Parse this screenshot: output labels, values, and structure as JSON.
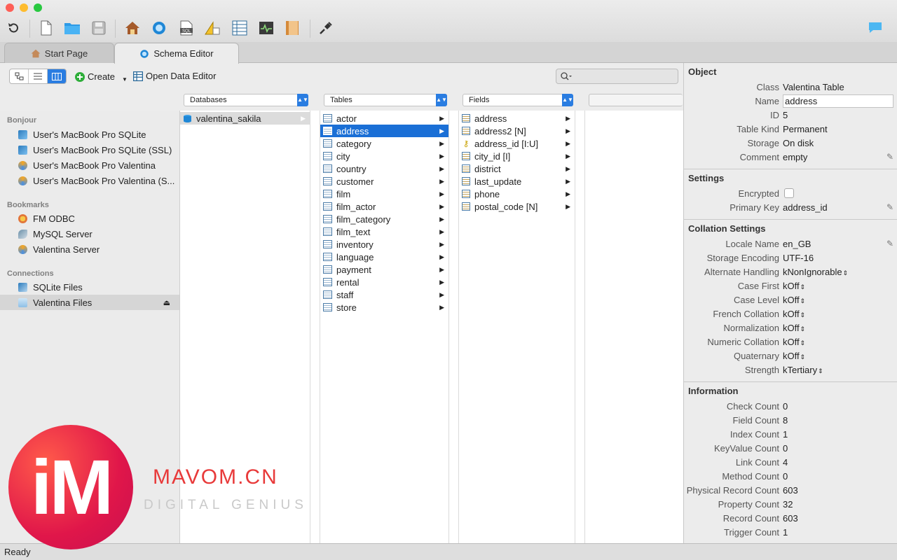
{
  "window": {
    "traffic_colors": [
      "#fe5f57",
      "#febc2e",
      "#28c840"
    ],
    "toolbar_icons": [
      "undo-icon",
      "new-file-icon",
      "open-folder-icon",
      "save-icon",
      "home-icon",
      "schema-editor-icon",
      "sql-editor-icon",
      "report-icon",
      "data-editor-icon",
      "diagnostics-icon",
      "book-icon",
      "connect-icon",
      "chat-icon"
    ]
  },
  "tabs": [
    {
      "label": "Start Page",
      "active": false
    },
    {
      "label": "Schema Editor",
      "active": true
    }
  ],
  "editor_toolbar": {
    "create_label": "Create",
    "open_data_editor_label": "Open Data Editor",
    "search_placeholder": ""
  },
  "columns": {
    "databases_header": "Databases",
    "tables_header": "Tables",
    "fields_header": "Fields"
  },
  "sidebar": {
    "bonjour_header": "Bonjour",
    "bonjour_items": [
      "User's MacBook Pro SQLite",
      "User's MacBook Pro SQLite (SSL)",
      "User's MacBook Pro Valentina",
      "User's MacBook Pro Valentina (S..."
    ],
    "bookmarks_header": "Bookmarks",
    "bookmarks_items": [
      "FM ODBC",
      "MySQL Server",
      "Valentina Server"
    ],
    "connections_header": "Connections",
    "connections_items": [
      "SQLite Files",
      "Valentina Files"
    ],
    "selected": "Valentina Files"
  },
  "databases": [
    "valentina_sakila"
  ],
  "tables": [
    "actor",
    "address",
    "category",
    "city",
    "country",
    "customer",
    "film",
    "film_actor",
    "film_category",
    "film_text",
    "inventory",
    "language",
    "payment",
    "rental",
    "staff",
    "store"
  ],
  "selected_table": "address",
  "fields": [
    "address",
    "address2 [N]",
    "address_id [I:U]",
    "city_id [I]",
    "district",
    "last_update",
    "phone",
    "postal_code [N]"
  ],
  "inspector": {
    "object_header": "Object",
    "class_label": "Class",
    "class_value": "Valentina Table",
    "name_label": "Name",
    "name_value": "address",
    "id_label": "ID",
    "id_value": "5",
    "table_kind_label": "Table Kind",
    "table_kind_value": "Permanent",
    "storage_label": "Storage",
    "storage_value": "On disk",
    "comment_label": "Comment",
    "comment_value": "empty",
    "settings_header": "Settings",
    "encrypted_label": "Encrypted",
    "primary_key_label": "Primary Key",
    "primary_key_value": "address_id",
    "collation_header": "Collation Settings",
    "collation": [
      {
        "label": "Locale Name",
        "value": "en_GB"
      },
      {
        "label": "Storage Encoding",
        "value": "UTF-16"
      },
      {
        "label": "Alternate Handling",
        "value": "kNonIgnorable"
      },
      {
        "label": "Case First",
        "value": "kOff"
      },
      {
        "label": "Case Level",
        "value": "kOff"
      },
      {
        "label": "French Collation",
        "value": "kOff"
      },
      {
        "label": "Normalization",
        "value": "kOff"
      },
      {
        "label": "Numeric Collation",
        "value": "kOff"
      },
      {
        "label": "Quaternary",
        "value": "kOff"
      },
      {
        "label": "Strength",
        "value": "kTertiary"
      }
    ],
    "information_header": "Information",
    "information": [
      {
        "label": "Check Count",
        "value": "0"
      },
      {
        "label": "Field Count",
        "value": "8"
      },
      {
        "label": "Index Count",
        "value": "1"
      },
      {
        "label": "KeyValue Count",
        "value": "0"
      },
      {
        "label": "Link Count",
        "value": "4"
      },
      {
        "label": "Method Count",
        "value": "0"
      },
      {
        "label": "Physical Record Count",
        "value": "603"
      },
      {
        "label": "Property Count",
        "value": "32"
      },
      {
        "label": "Record Count",
        "value": "603"
      },
      {
        "label": "Trigger Count",
        "value": "1"
      }
    ]
  },
  "status": "Ready",
  "watermark": {
    "logo": "iM",
    "line1": "MAVOM.CN",
    "line2": "DIGITAL GENIUS"
  },
  "colors": {
    "accent": "#1a6fd6",
    "selection_gray": "#d6d6d6"
  }
}
